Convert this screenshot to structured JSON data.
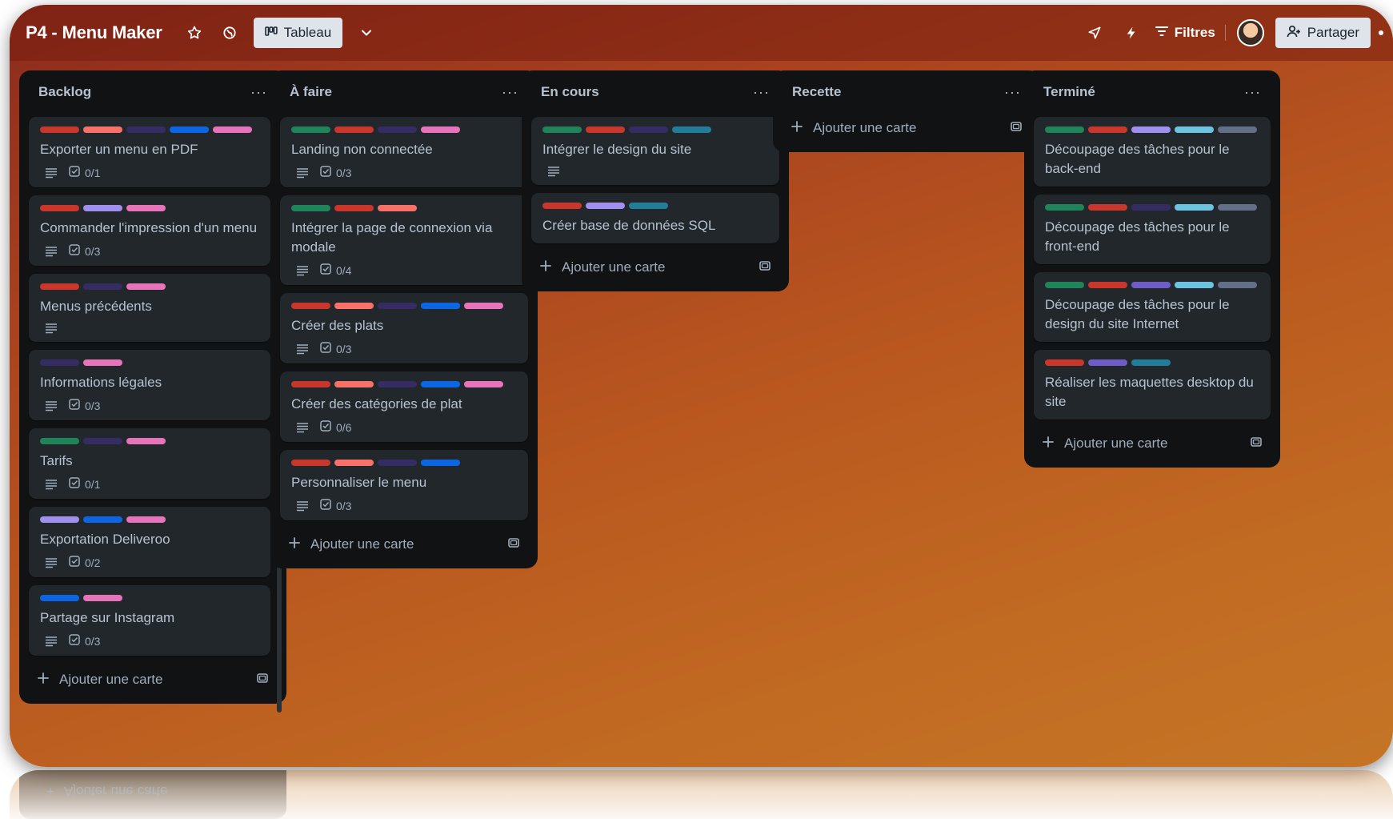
{
  "header": {
    "title": "P4 - Menu Maker",
    "view_label": "Tableau",
    "filters_label": "Filtres",
    "share_label": "Partager"
  },
  "colors": {
    "green": "#1f845a",
    "red": "#c9372c",
    "salmon": "#f87168",
    "navy": "#352c63",
    "blue": "#0c66e4",
    "pink": "#e774bb",
    "lavender": "#9f8fef",
    "purple": "#6e5dc6",
    "teal": "#227d9b",
    "sky": "#6cc3e0",
    "gray": "#626f86"
  },
  "add_card_label": "Ajouter une carte",
  "lists": [
    {
      "title": "Backlog",
      "cards": [
        {
          "title": "Exporter un menu en PDF",
          "labels": [
            "red",
            "salmon",
            "navy",
            "blue",
            "pink"
          ],
          "description": true,
          "checklist": "0/1"
        },
        {
          "title": "Commander l'impression d'un menu",
          "labels": [
            "red",
            "lavender",
            "pink"
          ],
          "description": true,
          "checklist": "0/3"
        },
        {
          "title": "Menus précédents",
          "labels": [
            "red",
            "navy",
            "pink"
          ],
          "description": true,
          "checklist": ""
        },
        {
          "title": "Informations légales",
          "labels": [
            "navy",
            "pink"
          ],
          "description": true,
          "checklist": "0/3"
        },
        {
          "title": "Tarifs",
          "labels": [
            "green",
            "navy",
            "pink"
          ],
          "description": true,
          "checklist": "0/1"
        },
        {
          "title": "Exportation Deliveroo",
          "labels": [
            "lavender",
            "blue",
            "pink"
          ],
          "description": true,
          "checklist": "0/2"
        },
        {
          "title": "Partage sur Instagram",
          "labels": [
            "blue",
            "pink"
          ],
          "description": true,
          "checklist": "0/3"
        }
      ]
    },
    {
      "title": "À faire",
      "cards": [
        {
          "title": "Landing non connectée",
          "labels": [
            "green",
            "red",
            "navy",
            "pink"
          ],
          "description": true,
          "checklist": "0/3"
        },
        {
          "title": "Intégrer la page de connexion via modale",
          "labels": [
            "green",
            "red",
            "salmon"
          ],
          "description": true,
          "checklist": "0/4"
        },
        {
          "title": "Créer des plats",
          "labels": [
            "red",
            "salmon",
            "navy",
            "blue",
            "pink"
          ],
          "description": true,
          "checklist": "0/3"
        },
        {
          "title": "Créer des catégories de plat",
          "labels": [
            "red",
            "salmon",
            "navy",
            "blue",
            "pink"
          ],
          "description": true,
          "checklist": "0/6"
        },
        {
          "title": "Personnaliser le menu",
          "labels": [
            "red",
            "salmon",
            "navy",
            "blue"
          ],
          "description": true,
          "checklist": "0/3"
        }
      ]
    },
    {
      "title": "En cours",
      "cards": [
        {
          "title": "Intégrer le design du site",
          "labels": [
            "green",
            "red",
            "navy",
            "teal"
          ],
          "description": true,
          "checklist": ""
        },
        {
          "title": "Créer base de données SQL",
          "labels": [
            "red",
            "lavender",
            "teal"
          ],
          "description": false,
          "checklist": ""
        }
      ]
    },
    {
      "title": "Recette",
      "cards": []
    },
    {
      "title": "Terminé",
      "cards": [
        {
          "title": "Découpage des tâches pour le back-end",
          "labels": [
            "green",
            "red",
            "lavender",
            "sky",
            "gray"
          ],
          "description": false,
          "checklist": ""
        },
        {
          "title": "Découpage des tâches pour le front-end",
          "labels": [
            "green",
            "red",
            "navy",
            "sky",
            "gray"
          ],
          "description": false,
          "checklist": ""
        },
        {
          "title": "Découpage des tâches pour le design du site Internet",
          "labels": [
            "green",
            "red",
            "purple",
            "sky",
            "gray"
          ],
          "description": false,
          "checklist": ""
        },
        {
          "title": "Réaliser les maquettes desktop du site",
          "labels": [
            "red",
            "purple",
            "teal"
          ],
          "description": false,
          "checklist": ""
        }
      ]
    }
  ]
}
